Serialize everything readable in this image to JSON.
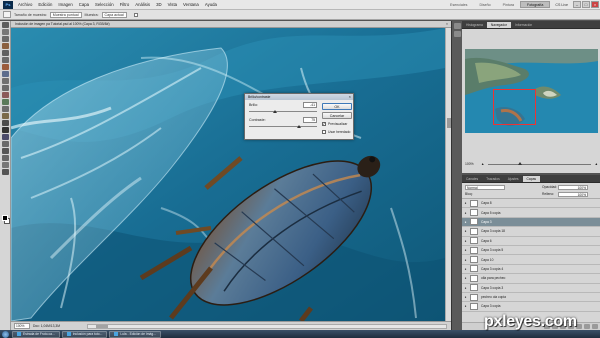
{
  "menubar": {
    "logo": "Ps",
    "items": [
      "Archivo",
      "Edición",
      "Imagen",
      "Capa",
      "Selección",
      "Filtro",
      "Análisis",
      "3D",
      "Vista",
      "Ventana",
      "Ayuda"
    ],
    "workspaces": [
      "Esenciales",
      "Diseño",
      "Pintura",
      "Fotografía"
    ],
    "active_workspace": "Fotografía",
    "cs_live": "CS Live"
  },
  "optbar": {
    "brush_size_label": "Tamaño de muestra:",
    "brush_size_value": "Muestra puntual",
    "sample_label": "Muestra:",
    "sample_value": "Capa actual"
  },
  "document": {
    "title": "Inclusión de imagen pa Tutorial.psd al 100% (Capa 3, RGB/8#)",
    "close": "×",
    "zoom": "100%",
    "info": "Doc: 1,04M/13,3M"
  },
  "dialog": {
    "title": "Brillo/contraste",
    "brightness_label": "Brillo:",
    "brightness_value": "-41",
    "contrast_label": "Contraste:",
    "contrast_value": "75",
    "ok": "OK",
    "cancel": "Cancelar",
    "preview": "Previsualizar",
    "legacy": "Usar heredado",
    "preview_checked": true,
    "legacy_checked": false
  },
  "navigator": {
    "tabs": [
      "Histograma",
      "Navegador",
      "Información"
    ],
    "active_tab": "Navegador",
    "zoom": "100%"
  },
  "layers_panel": {
    "tabs": [
      "Canales",
      "Trazados",
      "Ajustes",
      "Capas"
    ],
    "active_tab": "Capas",
    "blend_mode": "Normal",
    "opacity_label": "Opacidad:",
    "opacity": "100%",
    "fill_label": "Relleno:",
    "fill": "100%",
    "lock_label": "Bloq:",
    "layers": [
      {
        "name": "Capa 8",
        "selected": false
      },
      {
        "name": "Capa 5 copia",
        "selected": false
      },
      {
        "name": "Capa 3",
        "selected": true
      },
      {
        "name": "Capa 3 copia 18",
        "selected": false
      },
      {
        "name": "Capa 6",
        "selected": false
      },
      {
        "name": "Capa 3 copia 5",
        "selected": false
      },
      {
        "name": "Capa 10",
        "selected": false
      },
      {
        "name": "Capa 3 copia 4",
        "selected": false
      },
      {
        "name": "olla para pecheo",
        "selected": false
      },
      {
        "name": "Capa 3 copia 3",
        "selected": false
      },
      {
        "name": "pecheo ola copia",
        "selected": false
      },
      {
        "name": "Capa 3 copia",
        "selected": false
      }
    ]
  },
  "taskbar": {
    "apps": [
      "Estrada de Fruto.ca...",
      "Inclusión para tuto...",
      "Lula - Edición de Imág..."
    ]
  },
  "watermark": "pxleyes.com",
  "colors": {
    "water": "#1b6f91",
    "selected_layer": "#7b8e98",
    "nav_rect": "#e33"
  }
}
